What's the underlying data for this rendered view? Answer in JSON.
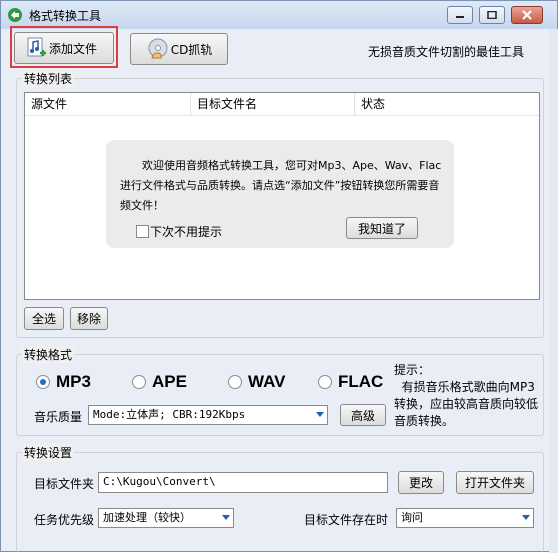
{
  "window": {
    "title": "格式转换工具"
  },
  "toolbar": {
    "add_file": "添加文件",
    "cd_rip": "CD抓轨",
    "slogan": "无损音质文件切割的最佳工具"
  },
  "convert_list": {
    "label": "转换列表",
    "columns": [
      "源文件",
      "目标文件名",
      "状态"
    ],
    "welcome": {
      "text": "欢迎使用音频格式转换工具，您可对Mp3、Ape、Wav、Flac进行文件格式与品质转换。请点选“添加文件”按钮转换您所需要音频文件！",
      "no_show_label": "下次不用提示",
      "no_show_checked": false,
      "ok_button": "我知道了"
    },
    "select_all": "全选",
    "remove": "移除"
  },
  "convert_format": {
    "label": "转换格式",
    "options": [
      "MP3",
      "APE",
      "WAV",
      "FLAC"
    ],
    "selected": "MP3",
    "quality_label": "音乐质量",
    "quality_value": "Mode:立体声; CBR:192Kbps",
    "advanced": "高级",
    "tip": "提示：\n  有损音乐格式歌曲向MP3转换，应由较高音质向较低音质转换。"
  },
  "convert_settings": {
    "label": "转换设置",
    "target_folder_label": "目标文件夹",
    "target_folder_value": "C:\\Kugou\\Convert\\",
    "change": "更改",
    "open_folder": "打开文件夹",
    "priority_label": "任务优先级",
    "priority_value": "加速处理（较快）",
    "exists_label": "目标文件存在时",
    "exists_value": "询问"
  },
  "colors": {
    "highlight": "#e23b3b",
    "radio_accent": "#1e72c8",
    "combo_arrow": "#2a5ea8"
  }
}
